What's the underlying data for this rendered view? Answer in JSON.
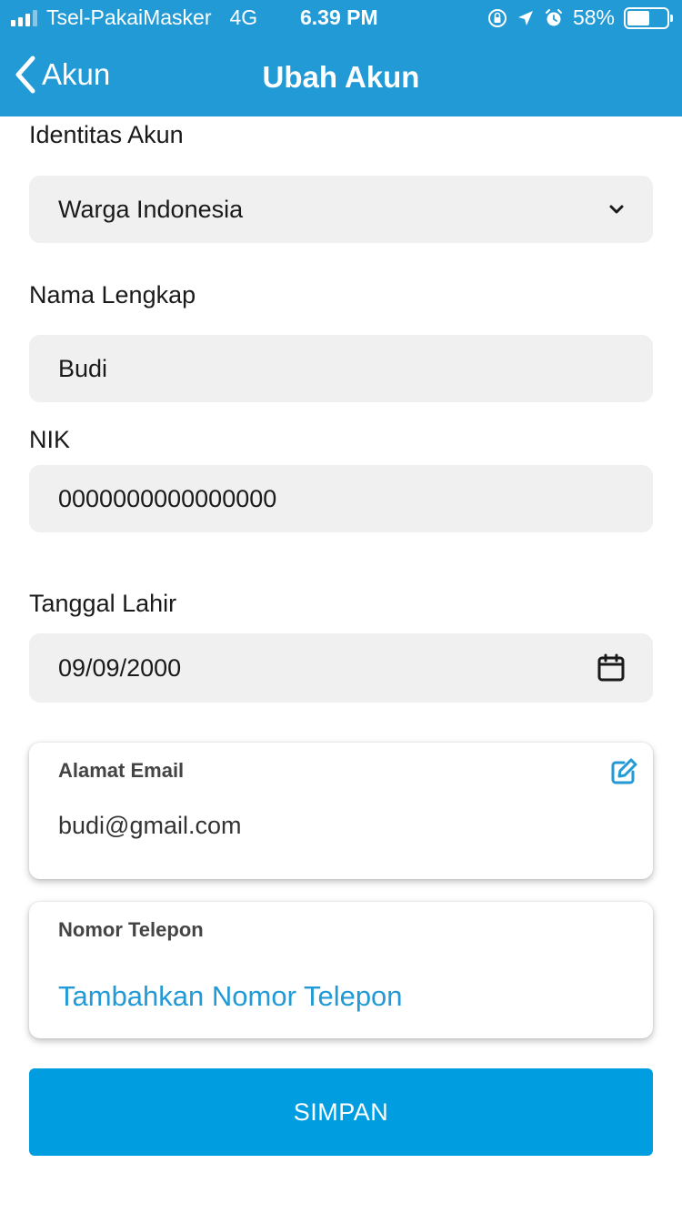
{
  "status_bar": {
    "carrier": "Tsel-PakaiMasker",
    "network": "4G",
    "time": "6.39 PM",
    "battery_percent_label": "58%",
    "battery_level": 0.58,
    "icons": [
      "signal-icon",
      "orientation-lock-icon",
      "location-arrow-icon",
      "alarm-icon",
      "battery-icon"
    ]
  },
  "nav": {
    "back_label": "Akun",
    "title": "Ubah Akun"
  },
  "form": {
    "identity": {
      "label": "Identitas Akun",
      "value": "Warga Indonesia",
      "icon": "chevron-down-icon"
    },
    "full_name": {
      "label": "Nama Lengkap",
      "value": "Budi"
    },
    "nik": {
      "label": "NIK",
      "value": "0000000000000000"
    },
    "birth_date": {
      "label": "Tanggal Lahir",
      "value": "09/09/2000",
      "icon": "calendar-icon"
    }
  },
  "email_card": {
    "title": "Alamat Email",
    "value": "budi@gmail.com",
    "icon": "edit-icon"
  },
  "phone_card": {
    "title": "Nomor Telepon",
    "action_label": "Tambahkan Nomor Telepon"
  },
  "save_button": {
    "label": "SIMPAN"
  },
  "colors": {
    "brand": "#229ad6",
    "button": "#009ee0",
    "field_bg": "#f0f0f0"
  }
}
